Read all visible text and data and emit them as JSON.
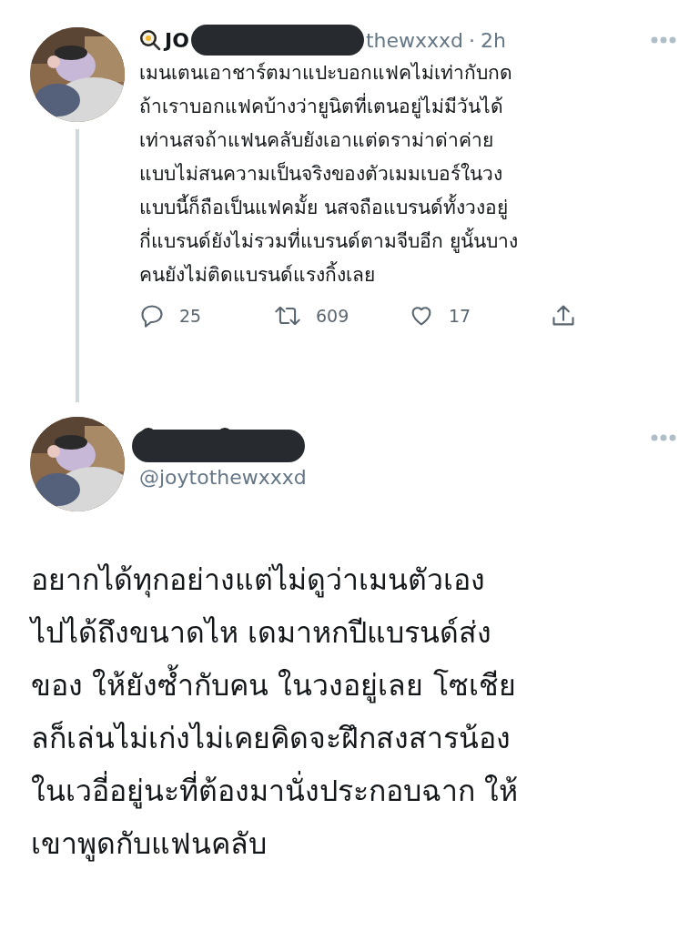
{
  "tweet": {
    "name": "JO",
    "handle": "thewxxxd",
    "separator": "·",
    "time": "2h",
    "text": "เมนเตนเอาชาร์ตมาแปะบอกแฟคไม่เท่ากับกด\nถ้าเราบอกแฟคบ้างว่ายูนิตที่เตนอยู่ไม่มีวันได้\nเท่านสจถ้าแฟนคลับยังเอาแต่ดราม่าด่าค่าย\nแบบไม่สนความเป็นจริงของตัวเมมเบอร์ในวง\nแบบนี้ก็ถือเป็นแฟคมั้ย นสจถือแบรนด์ทั้งวงอยู่\nกี่แบรนด์ยังไม่รวมที่แบรนด์ตามจีบอีก ยูนั้นบาง\nคนยังไม่ติดแบรนด์แรงกิ้งเลย",
    "actions": [
      {
        "kind": "reply",
        "count": "25"
      },
      {
        "kind": "retweet",
        "count": "609"
      },
      {
        "kind": "like",
        "count": "17"
      },
      {
        "kind": "share"
      }
    ]
  },
  "reply": {
    "handle": "@joytothewxxxd",
    "text": "อยากได้ทุกอย่างแต่ไม่ดูว่าเมนตัวเอง\nไปได้ถึงขนาดไห เดมาหกปีแบรนด์ส่ง\nของ ให้ยังซ้ำกับคน ในวงอยู่เลย โซเชีย\nลก็เล่นไม่เก่งไม่เคยคิดจะฝึกสงสารน้อง\nในเวอี่อยู่นะที่ต้องมานั่งประกอบฉาก ให้\nเขาพูดกับแฟนคลับ"
  }
}
